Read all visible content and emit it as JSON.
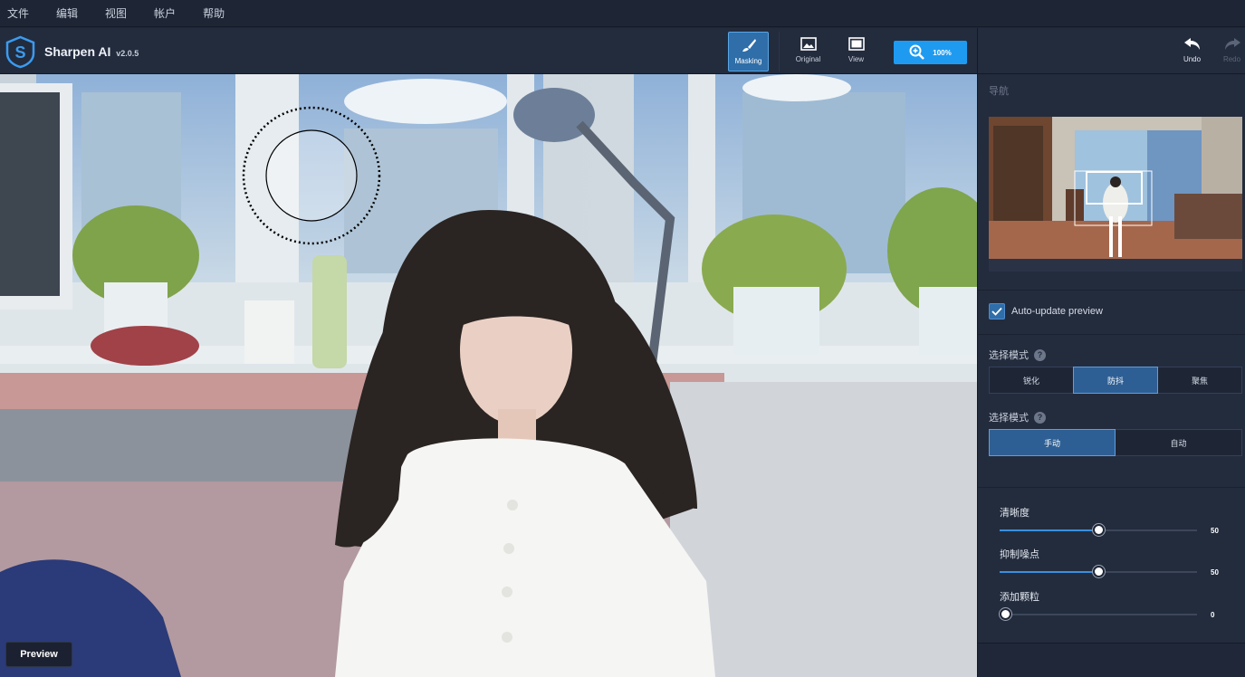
{
  "menu": {
    "items": [
      "文件",
      "编辑",
      "视图",
      "帐户",
      "帮助"
    ]
  },
  "app": {
    "title": "Sharpen AI",
    "version": "v2.0.5"
  },
  "toolbar": {
    "masking_label": "Masking",
    "original_label": "Original",
    "view_label": "View",
    "zoom_value": "100%",
    "undo_label": "Undo",
    "redo_label": "Redo"
  },
  "canvas": {
    "preview_label": "Preview"
  },
  "panel": {
    "nav_title": "导航",
    "auto_update_label": "Auto-update preview",
    "auto_update_checked": true,
    "mode1": {
      "label": "选择模式",
      "options": [
        "锐化",
        "防抖",
        "聚焦"
      ],
      "selected": "防抖"
    },
    "mode2": {
      "label": "选择模式",
      "options": [
        "手动",
        "自动"
      ],
      "selected": "手动"
    },
    "sliders": [
      {
        "label": "清晰度",
        "value": "50",
        "fraction": 0.5
      },
      {
        "label": "抑制噪点",
        "value": "50",
        "fraction": 0.5
      },
      {
        "label": "添加颗粒",
        "value": "0",
        "fraction": 0.0
      }
    ]
  },
  "colors": {
    "accent": "#1e9bf0",
    "active_button": "#2f6ea8",
    "panel_bg": "#232c3d"
  }
}
